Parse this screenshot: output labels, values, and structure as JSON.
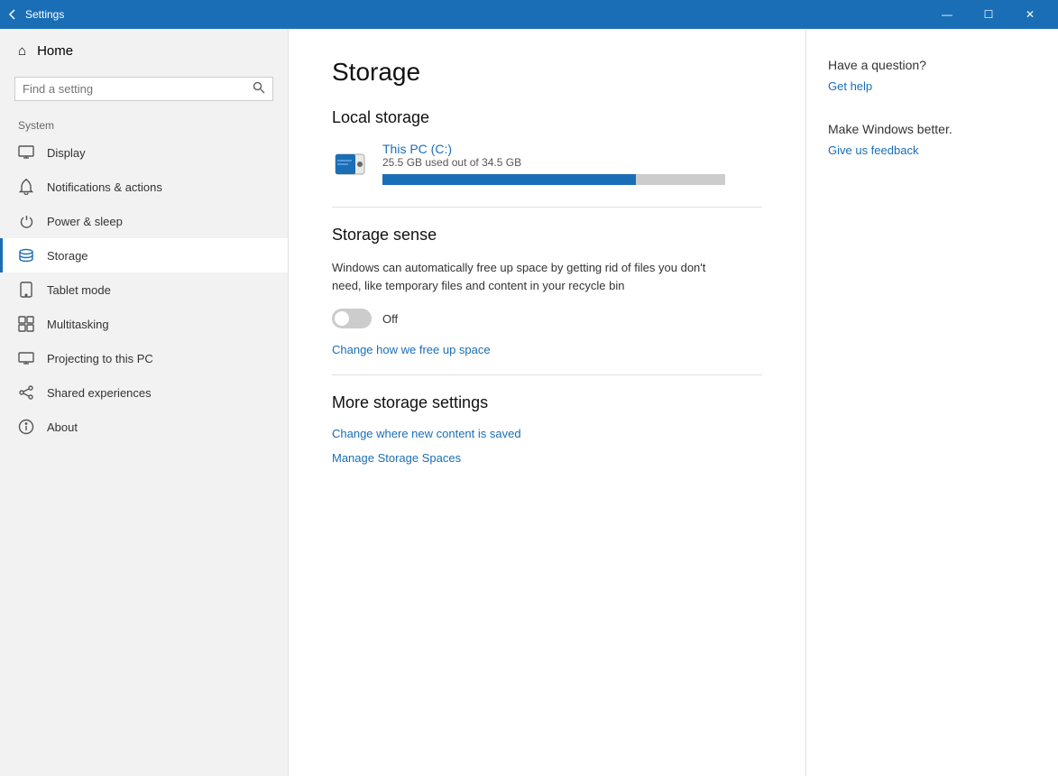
{
  "titlebar": {
    "title": "Settings",
    "back_label": "←",
    "minimize": "—",
    "maximize": "☐",
    "close": "✕"
  },
  "sidebar": {
    "home_label": "Home",
    "search_placeholder": "Find a setting",
    "section_label": "System",
    "items": [
      {
        "id": "display",
        "label": "Display",
        "icon": "☐"
      },
      {
        "id": "notifications",
        "label": "Notifications & actions",
        "icon": "🔔"
      },
      {
        "id": "power",
        "label": "Power & sleep",
        "icon": "⏻"
      },
      {
        "id": "storage",
        "label": "Storage",
        "icon": "💾",
        "active": true
      },
      {
        "id": "tablet",
        "label": "Tablet mode",
        "icon": "⬜"
      },
      {
        "id": "multitasking",
        "label": "Multitasking",
        "icon": "⧉"
      },
      {
        "id": "projecting",
        "label": "Projecting to this PC",
        "icon": "📺"
      },
      {
        "id": "shared",
        "label": "Shared experiences",
        "icon": "✱"
      },
      {
        "id": "about",
        "label": "About",
        "icon": "ℹ"
      }
    ]
  },
  "main": {
    "page_title": "Storage",
    "local_storage_title": "Local storage",
    "drive_name": "This PC (C:)",
    "drive_used": "25.5 GB used out of 34.5 GB",
    "drive_percent": 74,
    "storage_sense_title": "Storage sense",
    "storage_sense_description": "Windows can automatically free up space by getting rid of files you don't need, like temporary files and content in your recycle bin",
    "toggle_state": "Off",
    "change_space_link": "Change how we free up space",
    "more_settings_title": "More storage settings",
    "change_content_link": "Change where new content is saved",
    "manage_spaces_link": "Manage Storage Spaces"
  },
  "right_panel": {
    "have_question": "Have a question?",
    "get_help_link": "Get help",
    "make_better": "Make Windows better.",
    "feedback_link": "Give us feedback"
  }
}
